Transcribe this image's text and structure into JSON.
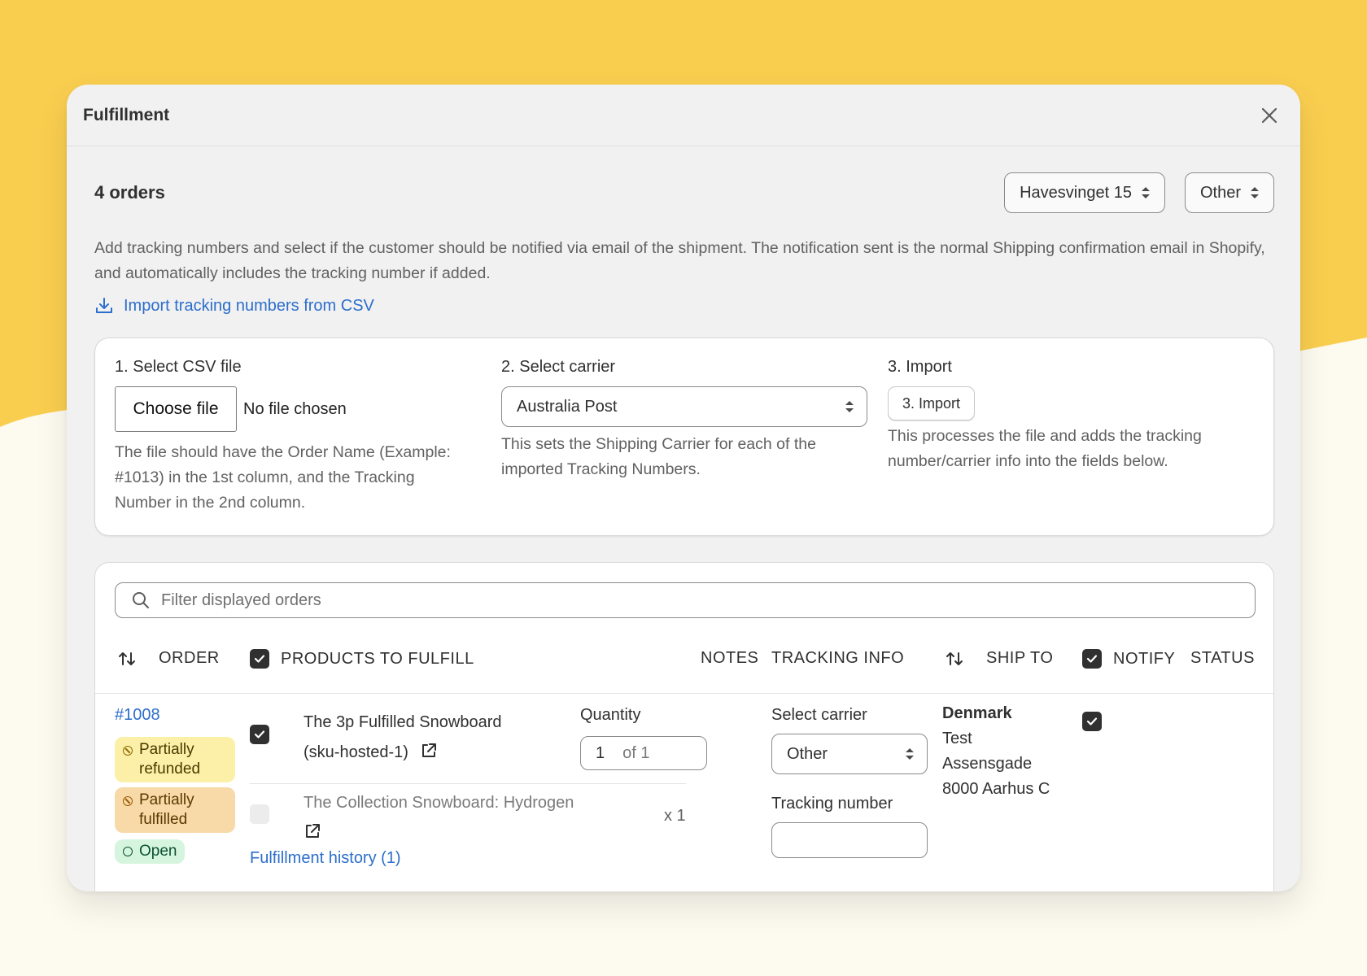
{
  "modal": {
    "title": "Fulfillment"
  },
  "toolbar": {
    "orders_count": "4 orders",
    "location_select": "Havesvinget 15",
    "carrier_select": "Other"
  },
  "description": "Add tracking numbers and select if the customer should be notified via email of the shipment. The notification sent is the normal Shipping confirmation email in Shopify, and automatically includes the tracking number if added.",
  "import_link": "Import tracking numbers from CSV",
  "csv_import": {
    "step1_title": "1. Select CSV file",
    "choose_file_label": "Choose file",
    "no_file_text": "No file chosen",
    "step1_help": "The file should have the Order Name (Example: #1013) in the 1st column, and the Tracking Number in the 2nd column.",
    "step2_title": "2. Select carrier",
    "carrier_value": "Australia Post",
    "step2_help": "This sets the Shipping Carrier for each of the imported Tracking Numbers.",
    "step3_title": "3. Import",
    "import_button": "3. Import",
    "step3_help": "This processes the file and adds the tracking number/carrier info into the fields below."
  },
  "orders_table": {
    "filter_placeholder": "Filter displayed orders",
    "headers": {
      "order": "ORDER",
      "products": "PRODUCTS TO FULFILL",
      "notes": "NOTES",
      "tracking": "TRACKING INFO",
      "ship_to": "SHIP TO",
      "notify": "NOTIFY",
      "status": "STATUS"
    },
    "row": {
      "order_name": "#1008",
      "badges": {
        "refund": [
          "Partially",
          "refunded"
        ],
        "fulfill": [
          "Partially",
          "fulfilled"
        ],
        "open": "Open"
      },
      "product1": {
        "name_line1": "The 3p Fulfilled Snowboard",
        "name_line2": "(sku-hosted-1)",
        "quantity_label": "Quantity",
        "quantity_value": "1",
        "quantity_of": "of 1"
      },
      "product2": {
        "name_line1": "The Collection Snowboard: Hydrogen",
        "quantity": "x 1"
      },
      "history_link": "Fulfillment history (1)",
      "tracking": {
        "carrier_label": "Select carrier",
        "carrier_value": "Other",
        "number_label": "Tracking number",
        "number_value": ""
      },
      "ship_to": {
        "country": "Denmark",
        "name": "Test",
        "street": "Assensgade",
        "city": "8000 Aarhus C"
      }
    }
  },
  "colors": {
    "background_yellow": "#f9ce4f",
    "link_blue": "#2c6ecb"
  }
}
